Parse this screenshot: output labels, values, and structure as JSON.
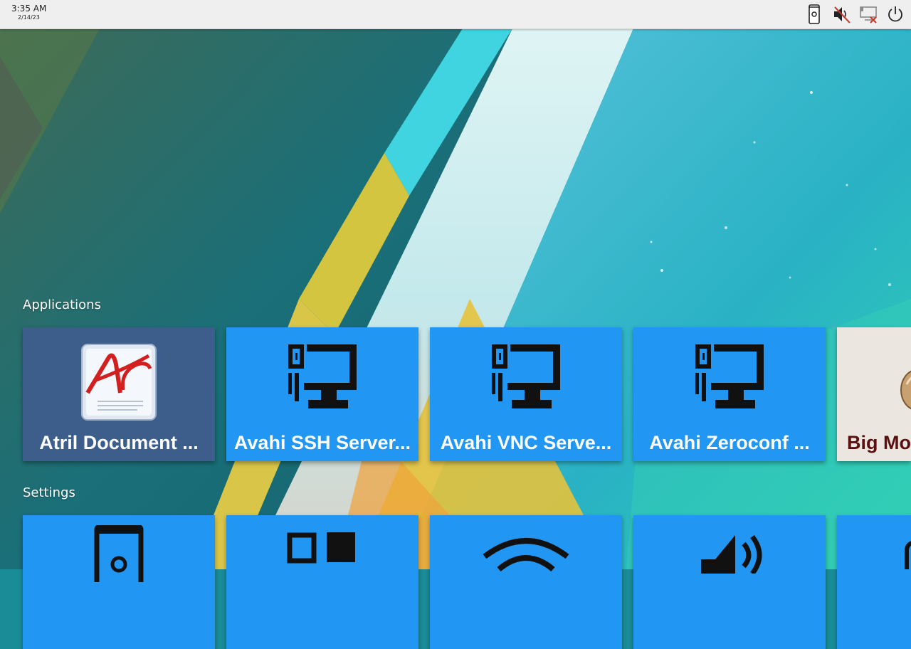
{
  "statusbar": {
    "time": "3:35 AM",
    "date": "2/14/23",
    "tray_icons": [
      "phone-settings-icon",
      "volume-muted-icon",
      "network-disconnected-icon",
      "power-icon"
    ]
  },
  "sections": {
    "applications_label": "Applications",
    "settings_label": "Settings"
  },
  "applications": [
    {
      "label": "Atril Document ...",
      "icon": "atril-document-viewer-icon"
    },
    {
      "label": "Avahi SSH Server...",
      "icon": "network-computer-icon"
    },
    {
      "label": "Avahi VNC Serve...",
      "icon": "network-computer-icon"
    },
    {
      "label": "Avahi Zeroconf ...",
      "icon": "network-computer-icon"
    },
    {
      "label": "Big Mo",
      "icon": "big-mouse-icon"
    }
  ],
  "settings": [
    {
      "icon": "phone-settings-icon"
    },
    {
      "icon": "window-layout-icon"
    },
    {
      "icon": "wifi-icon"
    },
    {
      "icon": "speaker-icon"
    },
    {
      "icon": "unknown-setting-icon"
    }
  ],
  "colors": {
    "tile_blue": "#2196f3",
    "tile_selected": "#3d5d8a",
    "topbar_bg": "#efefef",
    "icon_dark": "#1a1a1a"
  }
}
